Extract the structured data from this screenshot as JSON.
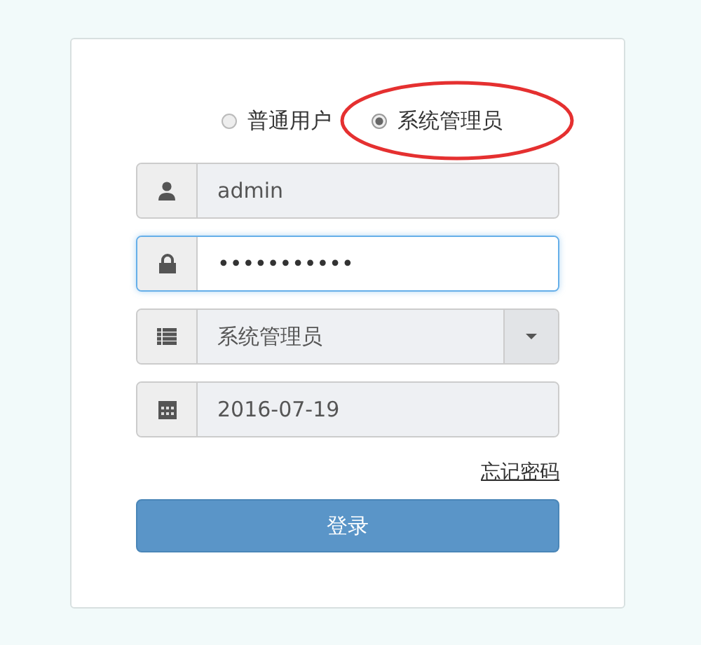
{
  "role_options": [
    {
      "label": "普通用户",
      "selected": false,
      "circled": false
    },
    {
      "label": "系统管理员",
      "selected": true,
      "circled": true
    }
  ],
  "fields": [
    {
      "kind": "user",
      "value": "admin",
      "disabled": true,
      "focused": false
    },
    {
      "kind": "password",
      "value": "•••••••••••",
      "disabled": false,
      "focused": true
    },
    {
      "kind": "select",
      "value": "系统管理员",
      "disabled": true,
      "focused": false
    },
    {
      "kind": "date",
      "value": "2016-07-19",
      "disabled": true,
      "focused": false
    }
  ],
  "forgot_link": "忘记密码",
  "login_button": "登录"
}
